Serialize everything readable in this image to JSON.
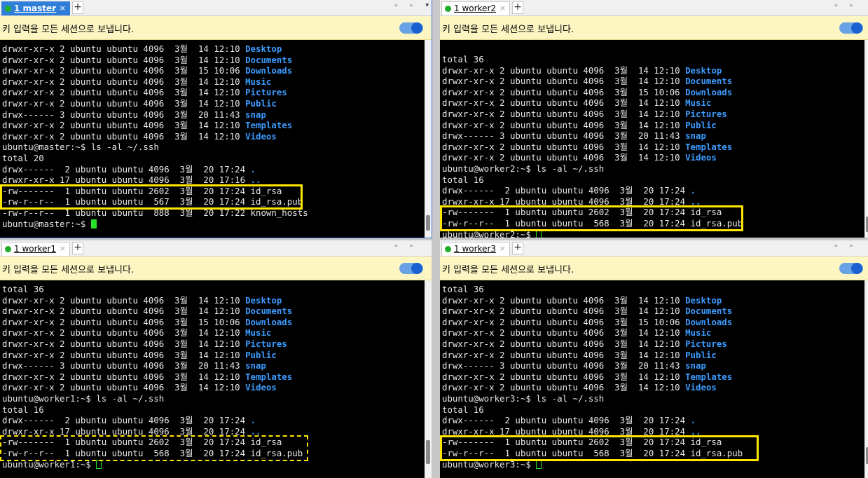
{
  "broadcast_text": "키 입력을 모든 세션으로 보냅니다.",
  "new_tab_label": "+",
  "close_label": "×",
  "nav_arrows": "◂ ▸",
  "menu_arrow": "▾",
  "colors": {
    "accent": "#2f7fd8",
    "highlight": "#ffe600",
    "dir": "#3b9bff",
    "cursor": "#27e227"
  },
  "panes": [
    {
      "tab_label": "1 master",
      "active": true,
      "lines": [
        {
          "t": "drwxr-xr-x 2 ubuntu ubuntu 4096  3월  14 12:10 ",
          "n": "Desktop"
        },
        {
          "t": "drwxr-xr-x 2 ubuntu ubuntu 4096  3월  14 12:10 ",
          "n": "Documents"
        },
        {
          "t": "drwxr-xr-x 2 ubuntu ubuntu 4096  3월  15 10:06 ",
          "n": "Downloads"
        },
        {
          "t": "drwxr-xr-x 2 ubuntu ubuntu 4096  3월  14 12:10 ",
          "n": "Music"
        },
        {
          "t": "drwxr-xr-x 2 ubuntu ubuntu 4096  3월  14 12:10 ",
          "n": "Pictures"
        },
        {
          "t": "drwxr-xr-x 2 ubuntu ubuntu 4096  3월  14 12:10 ",
          "n": "Public"
        },
        {
          "t": "drwx------ 3 ubuntu ubuntu 4096  3월  20 11:43 ",
          "n": "snap"
        },
        {
          "t": "drwxr-xr-x 2 ubuntu ubuntu 4096  3월  14 12:10 ",
          "n": "Templates"
        },
        {
          "t": "drwxr-xr-x 2 ubuntu ubuntu 4096  3월  14 12:10 ",
          "n": "Videos"
        },
        {
          "t": "ubuntu@master:~$ ls -al ~/.ssh",
          "n": ""
        },
        {
          "t": "total 20",
          "n": ""
        },
        {
          "t": "drwx------  2 ubuntu ubuntu 4096  3월  20 17:24 ",
          "n": "."
        },
        {
          "t": "drwxr-xr-x 17 ubuntu ubuntu 4096  3월  20 17:16 ",
          "n": ".."
        },
        {
          "t": "-rw-------  1 ubuntu ubuntu 2602  3월  20 17:24 id_rsa",
          "n": ""
        },
        {
          "t": "-rw-r--r--  1 ubuntu ubuntu  567  3월  20 17:24 id_rsa.pub",
          "n": ""
        },
        {
          "t": "-rw-r--r--  1 ubuntu ubuntu  888  3월  20 17:22 known_hosts",
          "n": ""
        },
        {
          "t": "ubuntu@master:~$ ",
          "n": "",
          "cursor": "solid"
        }
      ]
    },
    {
      "tab_label": "1 worker2",
      "active": false,
      "lines": [
        {
          "t": "total 36",
          "n": ""
        },
        {
          "t": "drwxr-xr-x 2 ubuntu ubuntu 4096  3월  14 12:10 ",
          "n": "Desktop"
        },
        {
          "t": "drwxr-xr-x 2 ubuntu ubuntu 4096  3월  14 12:10 ",
          "n": "Documents"
        },
        {
          "t": "drwxr-xr-x 2 ubuntu ubuntu 4096  3월  15 10:06 ",
          "n": "Downloads"
        },
        {
          "t": "drwxr-xr-x 2 ubuntu ubuntu 4096  3월  14 12:10 ",
          "n": "Music"
        },
        {
          "t": "drwxr-xr-x 2 ubuntu ubuntu 4096  3월  14 12:10 ",
          "n": "Pictures"
        },
        {
          "t": "drwxr-xr-x 2 ubuntu ubuntu 4096  3월  14 12:10 ",
          "n": "Public"
        },
        {
          "t": "drwx------ 3 ubuntu ubuntu 4096  3월  20 11:43 ",
          "n": "snap"
        },
        {
          "t": "drwxr-xr-x 2 ubuntu ubuntu 4096  3월  14 12:10 ",
          "n": "Templates"
        },
        {
          "t": "drwxr-xr-x 2 ubuntu ubuntu 4096  3월  14 12:10 ",
          "n": "Videos"
        },
        {
          "t": "ubuntu@worker2:~$ ls -al ~/.ssh",
          "n": ""
        },
        {
          "t": "total 16",
          "n": ""
        },
        {
          "t": "drwx------  2 ubuntu ubuntu 4096  3월  20 17:24 ",
          "n": "."
        },
        {
          "t": "drwxr-xr-x 17 ubuntu ubuntu 4096  3월  20 17:24 ",
          "n": ".."
        },
        {
          "t": "-rw-------  1 ubuntu ubuntu 2602  3월  20 17:24 id_rsa",
          "n": ""
        },
        {
          "t": "-rw-r--r--  1 ubuntu ubuntu  568  3월  20 17:24 id_rsa.pub",
          "n": ""
        },
        {
          "t": "ubuntu@worker2:~$ ",
          "n": "",
          "cursor": "hollow"
        }
      ]
    },
    {
      "tab_label": "1 worker1",
      "active": false,
      "lines": [
        {
          "t": "total 36",
          "n": ""
        },
        {
          "t": "drwxr-xr-x 2 ubuntu ubuntu 4096  3월  14 12:10 ",
          "n": "Desktop"
        },
        {
          "t": "drwxr-xr-x 2 ubuntu ubuntu 4096  3월  14 12:10 ",
          "n": "Documents"
        },
        {
          "t": "drwxr-xr-x 2 ubuntu ubuntu 4096  3월  15 10:06 ",
          "n": "Downloads"
        },
        {
          "t": "drwxr-xr-x 2 ubuntu ubuntu 4096  3월  14 12:10 ",
          "n": "Music"
        },
        {
          "t": "drwxr-xr-x 2 ubuntu ubuntu 4096  3월  14 12:10 ",
          "n": "Pictures"
        },
        {
          "t": "drwxr-xr-x 2 ubuntu ubuntu 4096  3월  14 12:10 ",
          "n": "Public"
        },
        {
          "t": "drwx------ 3 ubuntu ubuntu 4096  3월  20 11:43 ",
          "n": "snap"
        },
        {
          "t": "drwxr-xr-x 2 ubuntu ubuntu 4096  3월  14 12:10 ",
          "n": "Templates"
        },
        {
          "t": "drwxr-xr-x 2 ubuntu ubuntu 4096  3월  14 12:10 ",
          "n": "Videos"
        },
        {
          "t": "ubuntu@worker1:~$ ls -al ~/.ssh",
          "n": ""
        },
        {
          "t": "total 16",
          "n": ""
        },
        {
          "t": "drwx------  2 ubuntu ubuntu 4096  3월  20 17:24 ",
          "n": "."
        },
        {
          "t": "drwxr-xr-x 17 ubuntu ubuntu 4096  3월  20 17:24 ",
          "n": ".."
        },
        {
          "t": "-rw-------  1 ubuntu ubuntu 2602  3월  20 17:24 id_rsa",
          "n": ""
        },
        {
          "t": "-rw-r--r--  1 ubuntu ubuntu  568  3월  20 17:24 id_rsa.pub",
          "n": ""
        },
        {
          "t": "ubuntu@worker1:~$ ",
          "n": "",
          "cursor": "hollow"
        }
      ]
    },
    {
      "tab_label": "1 worker3",
      "active": false,
      "lines": [
        {
          "t": "total 36",
          "n": ""
        },
        {
          "t": "drwxr-xr-x 2 ubuntu ubuntu 4096  3월  14 12:10 ",
          "n": "Desktop"
        },
        {
          "t": "drwxr-xr-x 2 ubuntu ubuntu 4096  3월  14 12:10 ",
          "n": "Documents"
        },
        {
          "t": "drwxr-xr-x 2 ubuntu ubuntu 4096  3월  15 10:06 ",
          "n": "Downloads"
        },
        {
          "t": "drwxr-xr-x 2 ubuntu ubuntu 4096  3월  14 12:10 ",
          "n": "Music"
        },
        {
          "t": "drwxr-xr-x 2 ubuntu ubuntu 4096  3월  14 12:10 ",
          "n": "Pictures"
        },
        {
          "t": "drwxr-xr-x 2 ubuntu ubuntu 4096  3월  14 12:10 ",
          "n": "Public"
        },
        {
          "t": "drwx------ 3 ubuntu ubuntu 4096  3월  20 11:43 ",
          "n": "snap"
        },
        {
          "t": "drwxr-xr-x 2 ubuntu ubuntu 4096  3월  14 12:10 ",
          "n": "Templates"
        },
        {
          "t": "drwxr-xr-x 2 ubuntu ubuntu 4096  3월  14 12:10 ",
          "n": "Videos"
        },
        {
          "t": "ubuntu@worker3:~$ ls -al ~/.ssh",
          "n": ""
        },
        {
          "t": "total 16",
          "n": ""
        },
        {
          "t": "drwx------  2 ubuntu ubuntu 4096  3월  20 17:24 ",
          "n": "."
        },
        {
          "t": "drwxr-xr-x 17 ubuntu ubuntu 4096  3월  20 17:24 ",
          "n": ".."
        },
        {
          "t": "-rw-------  1 ubuntu ubuntu 2602  3월  20 17:24 id_rsa",
          "n": ""
        },
        {
          "t": "-rw-r--r--  1 ubuntu ubuntu  568  3월  20 17:24 id_rsa.pub",
          "n": ""
        },
        {
          "t": "ubuntu@worker3:~$ ",
          "n": "",
          "cursor": "hollow"
        }
      ]
    }
  ]
}
